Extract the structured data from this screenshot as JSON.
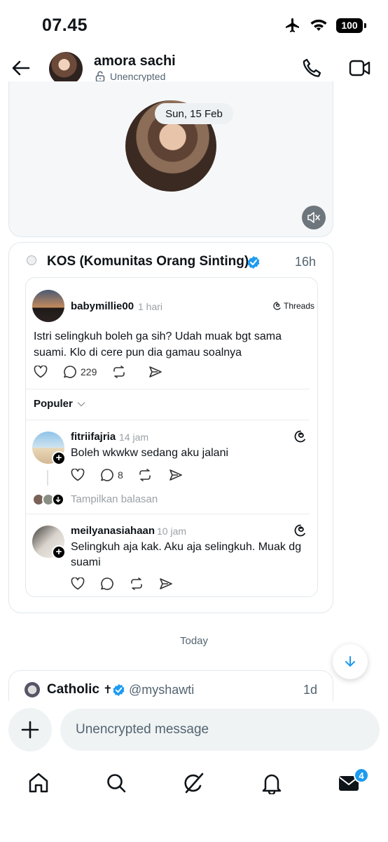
{
  "status_bar": {
    "time": "07.45",
    "battery": "100"
  },
  "header": {
    "name": "amora sachi",
    "encryption": "Unencrypted"
  },
  "video_card": {
    "date": "Sun, 15 Feb"
  },
  "post_card": {
    "title": "KOS (Komunitas Orang Sinting)",
    "time": "16h",
    "thread": {
      "username": "babymillie00",
      "ago": "1 hari",
      "source": "Threads",
      "text": "Istri selingkuh boleh ga sih? Udah muak bgt sama suami. Klo di cere pun dia gamau soalnya",
      "reply_count": "229",
      "sort_label": "Populer"
    },
    "comments": [
      {
        "username": "fitriifajria",
        "ago": "14 jam",
        "text": "Boleh wkwkw sedang aku jalani",
        "reply_count": "8"
      },
      {
        "username": "meilyanasiahaan",
        "ago": "10 jam",
        "text": "Selingkuh aja kak. Aku aja selingkuh. Muak dg suami"
      }
    ],
    "show_replies": "Tampilkan balasan"
  },
  "divider_label": "Today",
  "next_card": {
    "name": "Catholic",
    "name_suffix": "✝",
    "handle": "@myshawti",
    "time": "1d"
  },
  "composer": {
    "placeholder": "Unencrypted message"
  },
  "nav": {
    "messages_badge": "4",
    "icons": [
      "home-icon",
      "search-icon",
      "grok-icon",
      "bell-icon",
      "mail-icon"
    ]
  },
  "colors": {
    "accent": "#1d9bf0",
    "text": "#0f1419",
    "muted": "#536471"
  }
}
